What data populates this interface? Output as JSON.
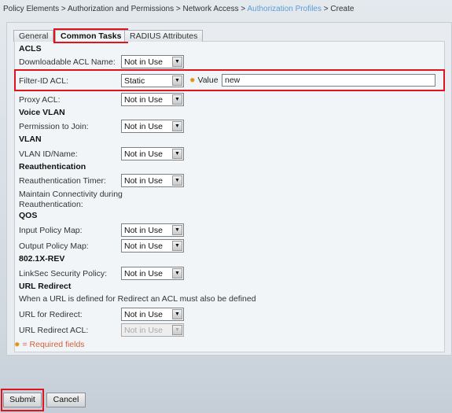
{
  "breadcrumb": [
    "Policy Elements",
    "Authorization and Permissions",
    "Network Access",
    "Authorization Profiles",
    "Create"
  ],
  "separator": " > ",
  "tabs": [
    "General",
    "Common Tasks",
    "RADIUS Attributes"
  ],
  "sections": {
    "acls": "ACLS",
    "voice": "Voice VLAN",
    "vlan": "VLAN",
    "reauth": "Reauthentication",
    "qos": "QOS",
    "rev": "802.1X-REV",
    "url": "URL Redirect"
  },
  "fields": {
    "dacl": {
      "label": "Downloadable ACL Name:",
      "value": "Not in Use"
    },
    "filter": {
      "label": "Filter-ID ACL:",
      "value": "Static",
      "value_label": "Value",
      "input": "new"
    },
    "proxy": {
      "label": "Proxy ACL:",
      "value": "Not in Use"
    },
    "perm": {
      "label": "Permission to Join:",
      "value": "Not in Use"
    },
    "vlanid": {
      "label": "VLAN ID/Name:",
      "value": "Not in Use"
    },
    "timer": {
      "label": "Reauthentication Timer:",
      "value": "Not in Use"
    },
    "maintain": {
      "label1": "Maintain Connectivity during",
      "label2": "Reauthentication:"
    },
    "input": {
      "label": "Input Policy Map:",
      "value": "Not in Use"
    },
    "output": {
      "label": "Output Policy Map:",
      "value": "Not in Use"
    },
    "linksec": {
      "label": "LinkSec Security Policy:",
      "value": "Not in Use"
    },
    "urlnote": "When a URL is defined for Redirect an ACL must also be defined",
    "urlredir": {
      "label": "URL for Redirect:",
      "value": "Not in Use"
    },
    "urlacl": {
      "label": "URL Redirect ACL:",
      "value": "Not in Use"
    }
  },
  "required_note": "= Required fields",
  "buttons": {
    "submit": "Submit",
    "cancel": "Cancel"
  },
  "colors": {
    "highlight": "#e0141e",
    "required": "#e09010",
    "link": "#5a9fd4"
  }
}
